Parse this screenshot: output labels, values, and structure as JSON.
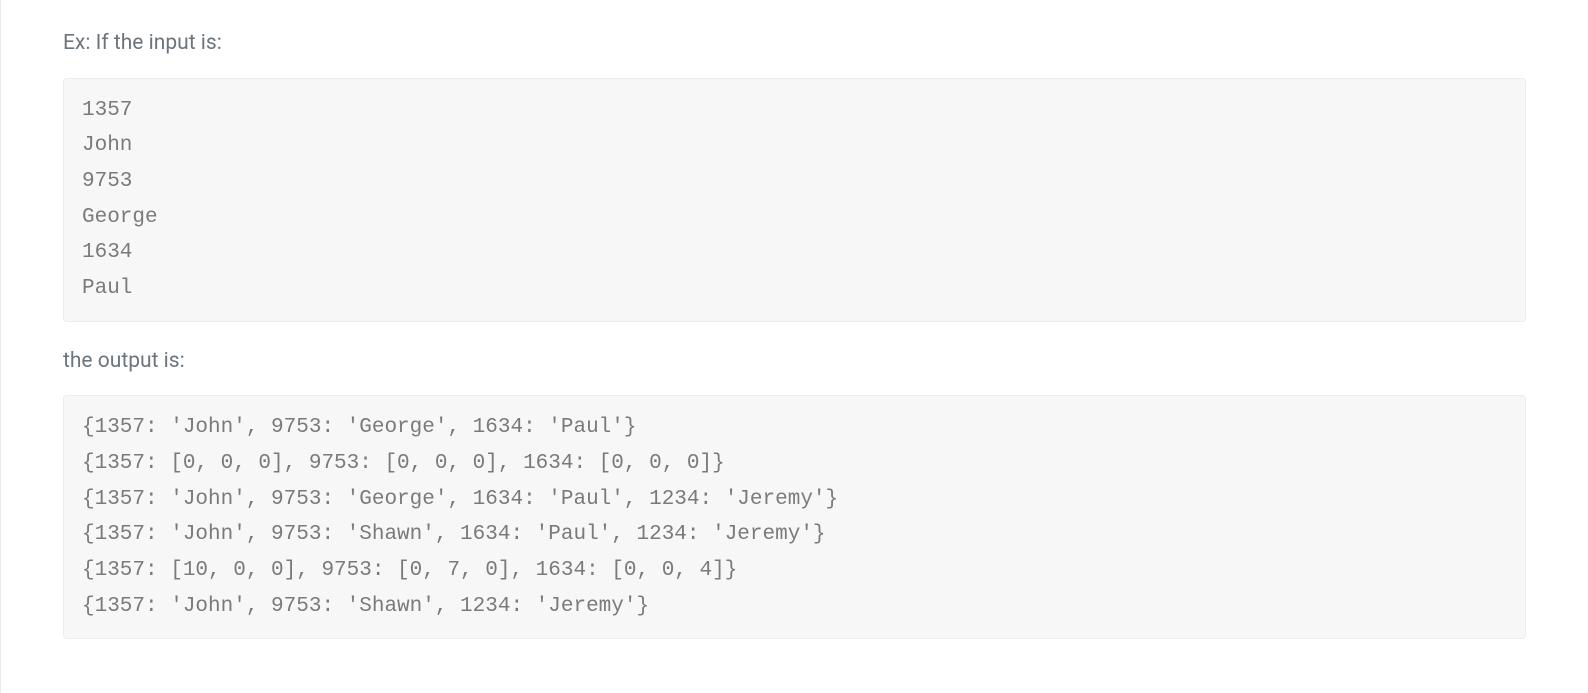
{
  "intro_text": "Ex: If the input is:",
  "input_block": "1357\nJohn\n9753\nGeorge\n1634\nPaul",
  "mid_text": "the output is:",
  "output_block": "{1357: 'John', 9753: 'George', 1634: 'Paul'}\n{1357: [0, 0, 0], 9753: [0, 0, 0], 1634: [0, 0, 0]}\n{1357: 'John', 9753: 'George', 1634: 'Paul', 1234: 'Jeremy'}\n{1357: 'John', 9753: 'Shawn', 1634: 'Paul', 1234: 'Jeremy'}\n{1357: [10, 0, 0], 9753: [0, 7, 0], 1634: [0, 0, 4]}\n{1357: 'John', 9753: 'Shawn', 1234: 'Jeremy'}"
}
